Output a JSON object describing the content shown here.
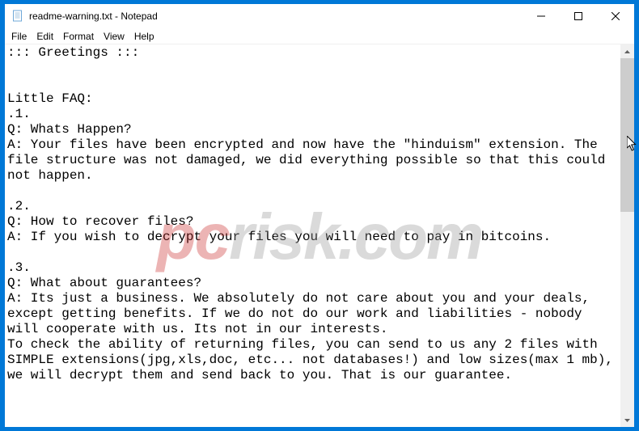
{
  "window": {
    "title": "readme-warning.txt - Notepad"
  },
  "menu": {
    "file": "File",
    "edit": "Edit",
    "format": "Format",
    "view": "View",
    "help": "Help"
  },
  "document": {
    "body": "::: Greetings :::\n\n\nLittle FAQ:\n.1.\nQ: Whats Happen?\nA: Your files have been encrypted and now have the \"hinduism\" extension. The file structure was not damaged, we did everything possible so that this could not happen.\n\n.2.\nQ: How to recover files?\nA: If you wish to decrypt your files you will need to pay in bitcoins.\n\n.3.\nQ: What about guarantees?\nA: Its just a business. We absolutely do not care about you and your deals, except getting benefits. If we do not do our work and liabilities - nobody will cooperate with us. Its not in our interests.\nTo check the ability of returning files, you can send to us any 2 files with SIMPLE extensions(jpg,xls,doc, etc... not databases!) and low sizes(max 1 mb), we will decrypt them and send back to you. That is our guarantee."
  },
  "watermark": {
    "prefix": "pc",
    "suffix": "risk.com"
  }
}
